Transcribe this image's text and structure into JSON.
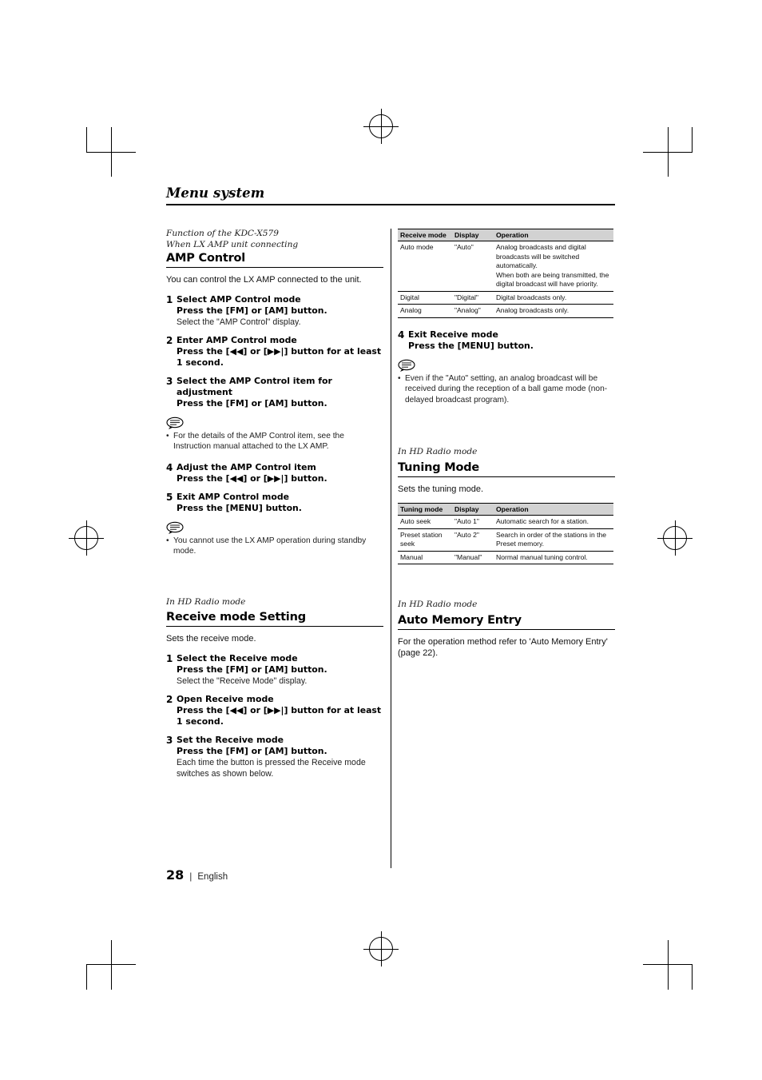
{
  "document": {
    "title": "Menu system",
    "page_number": "28",
    "language": "English",
    "separator": "|"
  },
  "left_column": {
    "intro_italic_line1": "Function of the KDC-X579",
    "intro_italic_line2": "When LX AMP unit connecting",
    "amp_control": {
      "heading": "AMP Control",
      "body": "You can control the LX AMP connected to the unit.",
      "steps": [
        {
          "num": "1",
          "title": "Select AMP Control mode",
          "sub": "Press the [FM] or [AM] button.",
          "desc": "Select the \"AMP Control\" display."
        },
        {
          "num": "2",
          "title": "Enter AMP Control mode",
          "sub": "Press the [◀◀] or [▶▶|] button for at least 1 second.",
          "desc": ""
        },
        {
          "num": "3",
          "title": "Select the AMP Control item for adjustment",
          "sub": "Press the [FM] or [AM] button.",
          "desc": ""
        }
      ],
      "note1": "For the details of the AMP Control item, see the Instruction manual attached to the LX AMP.",
      "steps2": [
        {
          "num": "4",
          "title": "Adjust the AMP Control item",
          "sub": "Press the [◀◀] or [▶▶|] button.",
          "desc": ""
        },
        {
          "num": "5",
          "title": "Exit AMP Control mode",
          "sub": "Press the [MENU] button.",
          "desc": ""
        }
      ],
      "note2": "You cannot use the LX AMP operation during standby mode."
    },
    "receive_mode": {
      "mode_italic": "In HD Radio mode",
      "heading": "Receive mode Setting",
      "body": "Sets the receive mode.",
      "steps": [
        {
          "num": "1",
          "title": "Select the Receive mode",
          "sub": "Press the [FM] or [AM] button.",
          "desc": "Select the \"Receive Mode\" display."
        },
        {
          "num": "2",
          "title": "Open Receive mode",
          "sub": "Press the [◀◀] or [▶▶|] button for at least 1 second.",
          "desc": ""
        },
        {
          "num": "3",
          "title": "Set the Receive mode",
          "sub": "Press the [FM] or [AM] button.",
          "desc": "Each time the button is pressed the Receive mode switches as shown below."
        }
      ]
    }
  },
  "right_column": {
    "receive_table": {
      "headers": [
        "Receive mode",
        "Display",
        "Operation"
      ],
      "rows": [
        {
          "mode": "Auto mode",
          "display": "\"Auto\"",
          "operation": "Analog broadcasts and digital broadcasts will be switched automatically.\nWhen both are being transmitted, the digital broadcast will have priority."
        },
        {
          "mode": "Digital",
          "display": "\"Digital\"",
          "operation": "Digital broadcasts only."
        },
        {
          "mode": "Analog",
          "display": "\"Analog\"",
          "operation": "Analog broadcasts only."
        }
      ]
    },
    "step4": {
      "num": "4",
      "title": "Exit Receive mode",
      "sub": "Press the [MENU] button."
    },
    "note": "Even if the \"Auto\" setting, an analog broadcast will be received during the reception of a ball game mode (non-delayed broadcast program).",
    "tuning_mode": {
      "mode_italic": "In HD Radio mode",
      "heading": "Tuning Mode",
      "body": "Sets the tuning mode.",
      "table": {
        "headers": [
          "Tuning mode",
          "Display",
          "Operation"
        ],
        "rows": [
          {
            "mode": "Auto seek",
            "display": "\"Auto 1\"",
            "operation": "Automatic search for a station."
          },
          {
            "mode": "Preset station seek",
            "display": "\"Auto 2\"",
            "operation": "Search in order of the stations in the Preset memory."
          },
          {
            "mode": "Manual",
            "display": "\"Manual\"",
            "operation": "Normal manual tuning control."
          }
        ]
      }
    },
    "auto_memory": {
      "mode_italic": "In HD Radio mode",
      "heading": "Auto Memory Entry",
      "body": "For the operation method refer to 'Auto Memory Entry' (page 22)."
    }
  }
}
